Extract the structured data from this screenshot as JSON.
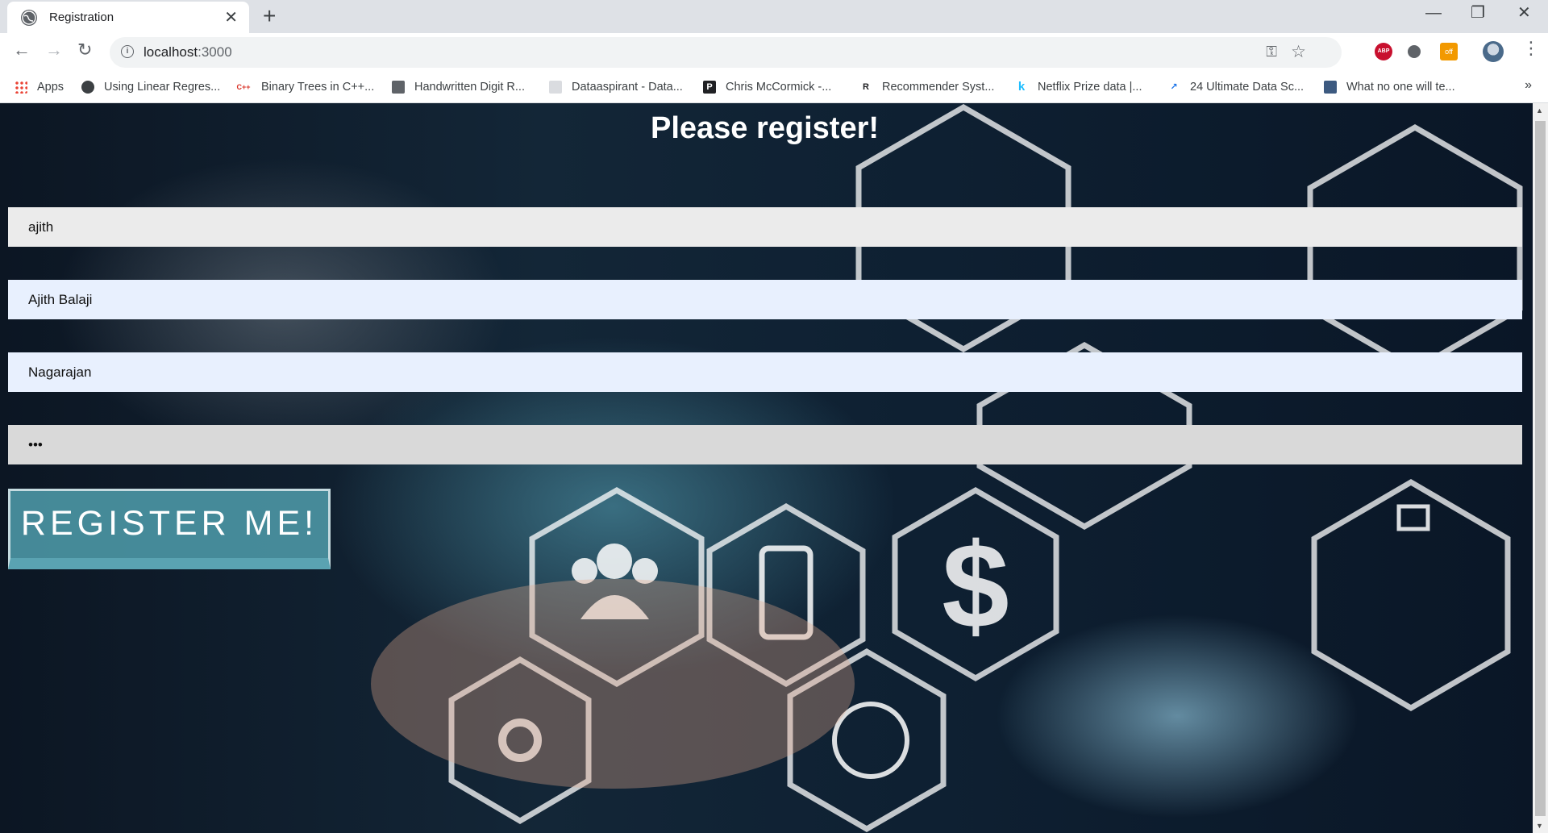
{
  "browser": {
    "tab_title": "Registration",
    "url_host": "localhost",
    "url_port": ":3000",
    "bookmarks": [
      {
        "label": "Apps",
        "icon": "apps-grid-icon"
      },
      {
        "label": "Using Linear Regres...",
        "icon": "site-icon"
      },
      {
        "label": "Binary Trees in C++...",
        "icon": "cpp-icon"
      },
      {
        "label": "Handwritten Digit R...",
        "icon": "site-icon"
      },
      {
        "label": "Dataaspirant - Data...",
        "icon": "site-icon"
      },
      {
        "label": "Chris McCormick -...",
        "icon": "p-icon"
      },
      {
        "label": "Recommender Syst...",
        "icon": "r-icon"
      },
      {
        "label": "Netflix Prize data |...",
        "icon": "k-icon"
      },
      {
        "label": "24 Ultimate Data Sc...",
        "icon": "chart-icon"
      },
      {
        "label": "What no one will te...",
        "icon": "site-icon"
      }
    ],
    "more_bookmarks": "»",
    "extensions": {
      "abp": "ABP",
      "off": "off"
    }
  },
  "page": {
    "title": "Please register!",
    "fields": {
      "username": "ajith",
      "first_name": "Ajith Balaji",
      "last_name": "Nagarajan",
      "password": "•••"
    },
    "submit_label": "REGISTER ME!"
  }
}
